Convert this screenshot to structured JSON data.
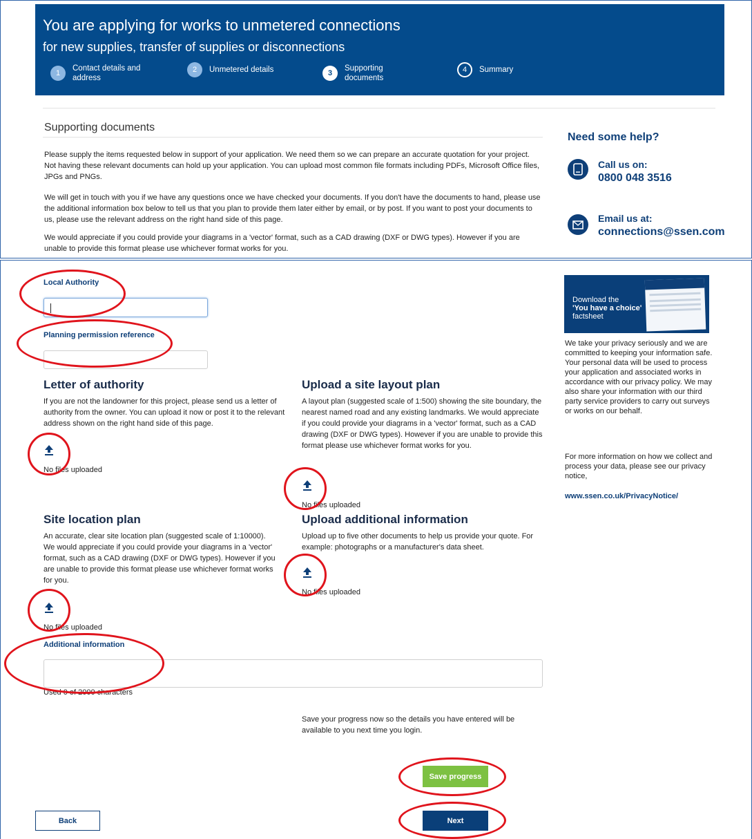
{
  "header": {
    "title": "You are applying for works to unmetered connections",
    "subtitle": "for new supplies, transfer of supplies or disconnections",
    "steps": [
      {
        "num": "1",
        "label_line1": "Contact details and",
        "label_line2": "address",
        "state": "done"
      },
      {
        "num": "2",
        "label_line1": "Unmetered details",
        "label_line2": "",
        "state": "done"
      },
      {
        "num": "3",
        "label_line1": "Supporting",
        "label_line2": "documents",
        "state": "current"
      },
      {
        "num": "4",
        "label_line1": "Summary",
        "label_line2": "",
        "state": "todo"
      }
    ]
  },
  "section": {
    "title": "Supporting documents",
    "para1": "Please supply the items requested below in support of your application. We need them so we can prepare an accurate quotation for your project. Not having these relevant documents can hold up your application. You can upload most common file formats including PDFs, Microsoft Office files, JPGs and PNGs.",
    "para2": "We will get in touch with you if we have any questions once we have checked your documents. If you don't have the documents to hand, please use the additional information box below to tell us that you plan to provide them later either by email, or by post. If you want to post your documents to us, please use the relevant address on the right hand side of this page.",
    "para3": "We would appreciate if you could provide your diagrams in a 'vector' format, such as a CAD drawing (DXF or DWG types). However if you are unable to provide this format please use whichever format works for you."
  },
  "help": {
    "title": "Need some help?",
    "call_label": "Call us on:",
    "phone": "0800 048 3516",
    "email_label": "Email us at:",
    "email": "connections@ssen.com"
  },
  "form": {
    "local_authority_label": "Local Authority",
    "local_authority_value": "",
    "planning_label": "Planning permission reference",
    "planning_value": "",
    "letter_title": "Letter of authority",
    "letter_desc": "If you are not the landowner for this project, please send us a letter of authority from the owner. You can upload it now or post it to the relevant address shown on the right hand side of this page.",
    "site_layout_title": "Upload a site layout plan",
    "site_layout_desc": "A layout plan (suggested scale of 1:500) showing the site boundary, the nearest named road and any existing landmarks. We would appreciate if you could provide your diagrams in a 'vector' format, such as a CAD drawing (DXF or DWG types). However if you are unable to provide this format please use whichever format works for you.",
    "site_location_title": "Site location plan",
    "site_location_desc": "An accurate, clear site location plan (suggested scale of 1:10000). We would appreciate if you could provide your diagrams in a 'vector' format, such as a CAD drawing (DXF or DWG types). However if you are unable to provide this format please use whichever format works for you.",
    "additional_upload_title": "Upload additional information",
    "additional_upload_desc": "Upload up to five other documents to help us provide your quote. For example: photographs or a manufacturer's data sheet.",
    "no_files": "No files uploaded",
    "additional_info_label": "Additional information",
    "additional_info_value": "",
    "char_count": "Used 0 of 2000 characters",
    "save_note": "Save your progress now so the details you have entered will be available to you next time you login.",
    "save_button": "Save progress",
    "next_button": "Next",
    "back_button": "Back"
  },
  "sidebar": {
    "promo_line1": "Download the",
    "promo_line2": "'You have a choice'",
    "promo_line3": "factsheet",
    "privacy_text": "We take your privacy seriously and we are committed to keeping your information safe. Your personal data will be used to process your application and associated works in accordance with our privacy policy. We may also share your information with our third party service providers to carry out surveys or works on our behalf.",
    "more_info_text": "For more information on how we collect and process your data, please see our privacy notice,",
    "privacy_link": "www.ssen.co.uk/PrivacyNotice/"
  },
  "colors": {
    "header_bg": "#044b8c",
    "navy": "#0e3f78",
    "save_green": "#7dc142",
    "annotation_red": "#e0141c"
  }
}
